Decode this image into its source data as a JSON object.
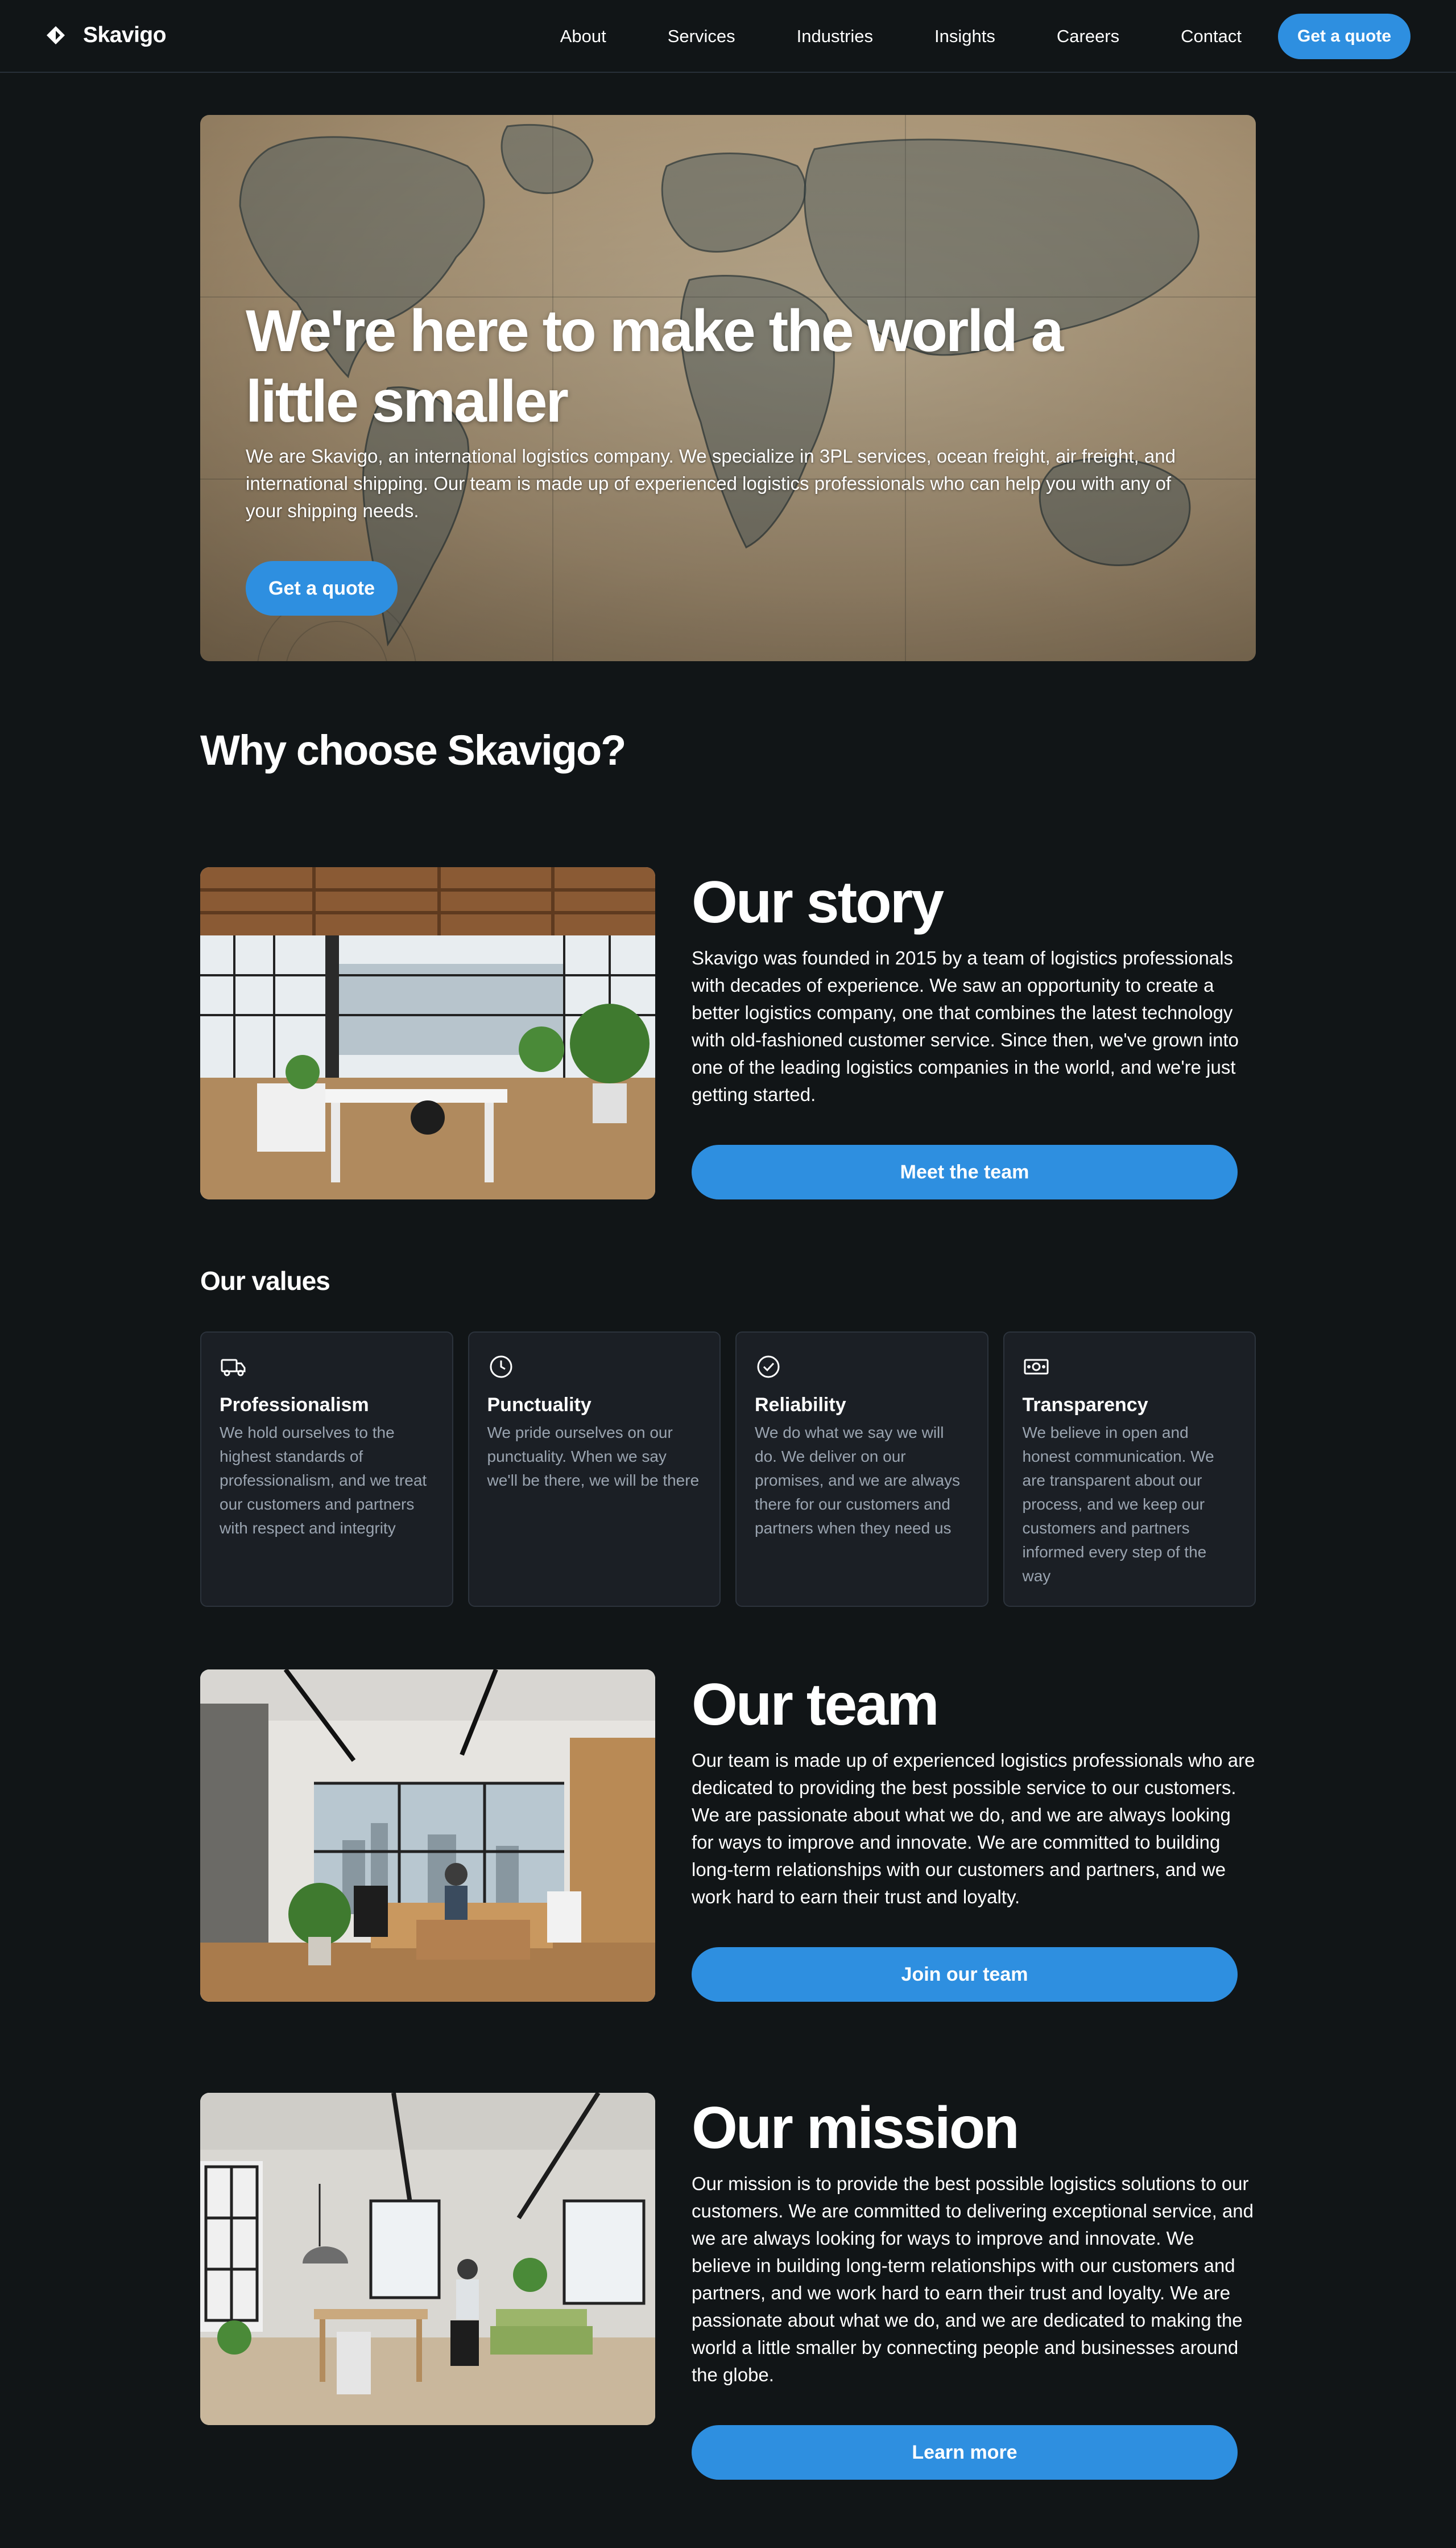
{
  "header": {
    "brand": "Skavigo",
    "nav": [
      "About",
      "Services",
      "Industries",
      "Insights",
      "Careers",
      "Contact"
    ],
    "cta": "Get a quote"
  },
  "hero": {
    "title": "We're here to make the world a little smaller",
    "text": "We are Skavigo, an international logistics company. We specialize in 3PL services, ocean freight, air freight, and international shipping. Our team is made up of experienced logistics professionals who can help you with any of your shipping needs.",
    "cta": "Get a quote"
  },
  "why": {
    "title": "Why choose Skavigo?"
  },
  "story": {
    "title": "Our story",
    "text": "Skavigo was founded in 2015 by a team of logistics professionals with decades of experience. We saw an opportunity to create a better logistics company, one that combines the latest technology with old-fashioned customer service. Since then, we've grown into one of the leading logistics companies in the world, and we're just getting started.",
    "cta": "Meet the team"
  },
  "values": {
    "title": "Our values",
    "items": [
      {
        "icon": "truck-icon",
        "title": "Professionalism",
        "text": "We hold ourselves to the highest standards of professionalism, and we treat our customers and partners with respect and integrity"
      },
      {
        "icon": "clock-icon",
        "title": "Punctuality",
        "text": "We pride ourselves on our punctuality. When we say we'll be there, we will be there"
      },
      {
        "icon": "check-circle-icon",
        "title": "Reliability",
        "text": "We do what we say we will do. We deliver on our promises, and we are always there for our customers and partners when they need us"
      },
      {
        "icon": "money-icon",
        "title": "Transparency",
        "text": "We believe in open and honest communication. We are transparent about our process, and we keep our customers and partners informed every step of the way"
      }
    ]
  },
  "team": {
    "title": "Our team",
    "text": "Our team is made up of experienced logistics professionals who are dedicated to providing the best possible service to our customers. We are passionate about what we do, and we are always looking for ways to improve and innovate. We are committed to building long-term relationships with our customers and partners, and we work hard to earn their trust and loyalty.",
    "cta": "Join our team"
  },
  "mission": {
    "title": "Our mission",
    "text": "Our mission is to provide the best possible logistics solutions to our customers. We are committed to delivering exceptional service, and we are always looking for ways to improve and innovate. We believe in building long-term relationships with our customers and partners, and we work hard to earn their trust and loyalty. We are passionate about what we do, and we are dedicated to making the world a little smaller by connecting people and businesses around the globe.",
    "cta": "Learn more"
  },
  "colors": {
    "background": "#111517",
    "accent": "#2e8fe0",
    "card": "#1b1f25",
    "muted": "#9aa4b0"
  }
}
